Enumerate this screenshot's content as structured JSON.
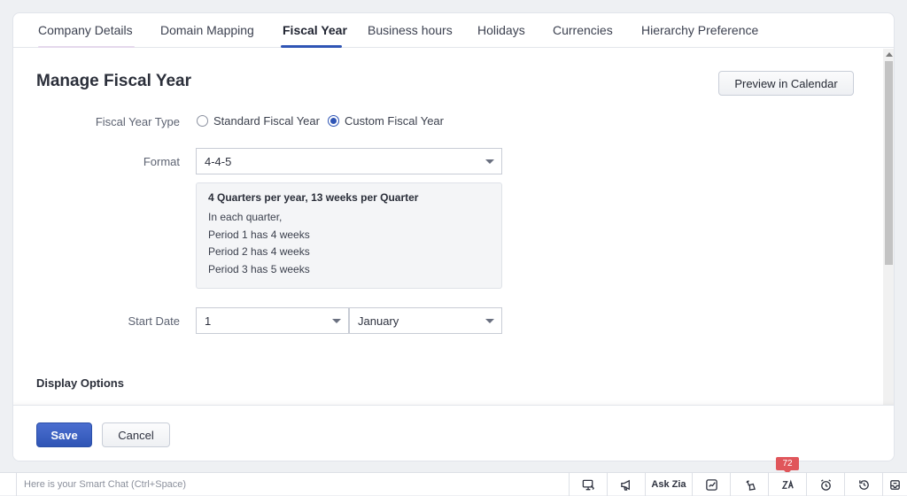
{
  "tabs": [
    {
      "label": "Company Details"
    },
    {
      "label": "Domain Mapping"
    },
    {
      "label": "Fiscal Year"
    },
    {
      "label": "Business hours"
    },
    {
      "label": "Holidays"
    },
    {
      "label": "Currencies"
    },
    {
      "label": "Hierarchy Preference"
    }
  ],
  "active_tab": "Fiscal Year",
  "page": {
    "title": "Manage Fiscal Year",
    "preview_button": "Preview in Calendar"
  },
  "fiscal_year_type": {
    "label": "Fiscal Year Type",
    "options": [
      "Standard Fiscal Year",
      "Custom Fiscal Year"
    ],
    "selected": "Custom Fiscal Year"
  },
  "format": {
    "label": "Format",
    "value": "4-4-5"
  },
  "format_info": {
    "title": "4 Quarters per year, 13 weeks per Quarter",
    "lines": [
      "In each quarter,",
      "Period 1 has 4 weeks",
      "Period 2 has 4 weeks",
      "Period 3 has 5 weeks"
    ]
  },
  "start_date": {
    "label": "Start Date",
    "day": "1",
    "month": "January"
  },
  "display_options": {
    "title": "Display Options"
  },
  "footer": {
    "save": "Save",
    "cancel": "Cancel"
  },
  "bottom_bar": {
    "chat_placeholder": "Here is your Smart Chat (Ctrl+Space)",
    "ask_zia": "Ask Zia",
    "notification_count": "72"
  },
  "colors": {
    "accent": "#2f55b5",
    "badge": "#e0565b"
  }
}
